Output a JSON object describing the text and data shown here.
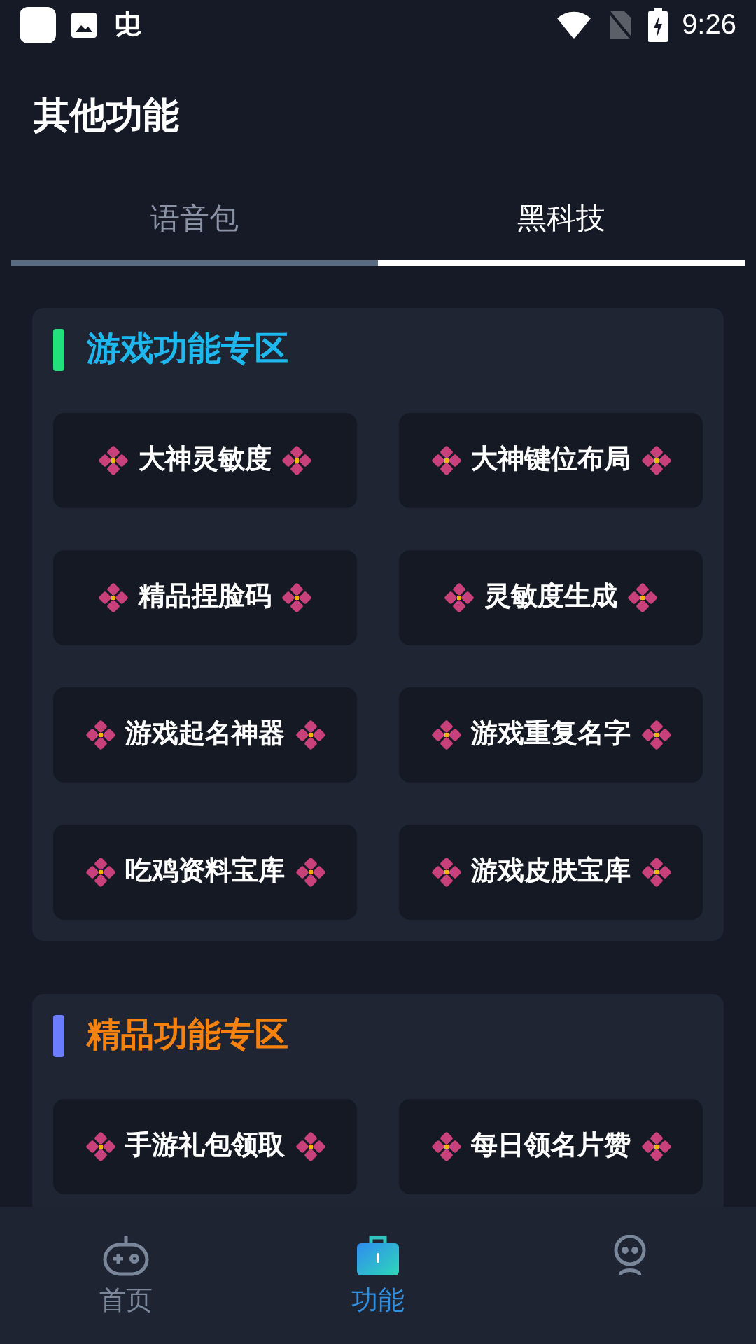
{
  "status_bar": {
    "time": "9:26"
  },
  "header": {
    "title": "其他功能"
  },
  "tabs": [
    {
      "label": "语音包",
      "selected": false
    },
    {
      "label": "黑科技",
      "selected": true
    }
  ],
  "sections": [
    {
      "title": "游戏功能专区",
      "kind": "game",
      "items": [
        "大神灵敏度",
        "大神键位布局",
        "精品捏脸码",
        "灵敏度生成",
        "游戏起名神器",
        "游戏重复名字",
        "吃鸡资料宝库",
        "游戏皮肤宝库"
      ]
    },
    {
      "title": "精品功能专区",
      "kind": "premium",
      "items": [
        "手游礼包领取",
        "每日领名片赞"
      ]
    }
  ],
  "bottom_nav": [
    {
      "kind": "gamepad",
      "label": "首页",
      "selected": false
    },
    {
      "kind": "toolbox",
      "label": "功能",
      "selected": true
    },
    {
      "kind": "person",
      "selected": false
    }
  ]
}
